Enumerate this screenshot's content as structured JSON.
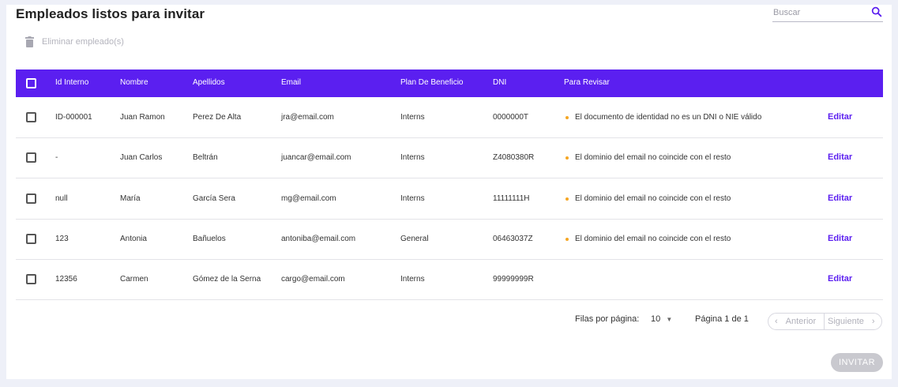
{
  "header": {
    "title": "Empleados listos para invitar"
  },
  "search": {
    "placeholder": "Buscar",
    "icon": "search-icon"
  },
  "toolbar": {
    "delete_label": "Eliminar empleado(s)",
    "delete_icon": "trash-icon"
  },
  "table": {
    "columns": [
      "Id Interno",
      "Nombre",
      "Apellidos",
      "Email",
      "Plan De Beneficio",
      "DNI",
      "Para Revisar"
    ],
    "edit_label": "Editar",
    "rows": [
      {
        "id": "ID-000001",
        "nombre": "Juan Ramon",
        "apellidos": "Perez De Alta",
        "email": "jra@email.com",
        "plan": "Interns",
        "dni": "0000000T",
        "revisar": "El documento de identidad no es un DNI o NIE válido"
      },
      {
        "id": "-",
        "nombre": "Juan Carlos",
        "apellidos": "Beltrán",
        "email": "juancar@email.com",
        "plan": "Interns",
        "dni": "Z4080380R",
        "revisar": "El dominio del email no coincide con el resto"
      },
      {
        "id": "null",
        "nombre": "María",
        "apellidos": "García Sera",
        "email": "mg@email.com",
        "plan": "Interns",
        "dni": "11111111H",
        "revisar": "El dominio del email no coincide con el resto"
      },
      {
        "id": "123",
        "nombre": "Antonia",
        "apellidos": "Bañuelos",
        "email": "antoniba@email.com",
        "plan": "General",
        "dni": "06463037Z",
        "revisar": "El dominio del email no coincide con el resto"
      },
      {
        "id": "12356",
        "nombre": "Carmen",
        "apellidos": "Gómez de la Serna",
        "email": "cargo@email.com",
        "plan": "Interns",
        "dni": "99999999R",
        "revisar": ""
      }
    ]
  },
  "pagination": {
    "rows_per_page_label": "Filas por página:",
    "rows_per_page_value": "10",
    "page_info": "Página 1 de 1",
    "prev_label": "Anterior",
    "next_label": "Siguiente"
  },
  "actions": {
    "invite_label": "INVITAR"
  },
  "colors": {
    "accent": "#5b1ff0",
    "warning": "#f5a623",
    "disabled": "#c9c9cf"
  }
}
